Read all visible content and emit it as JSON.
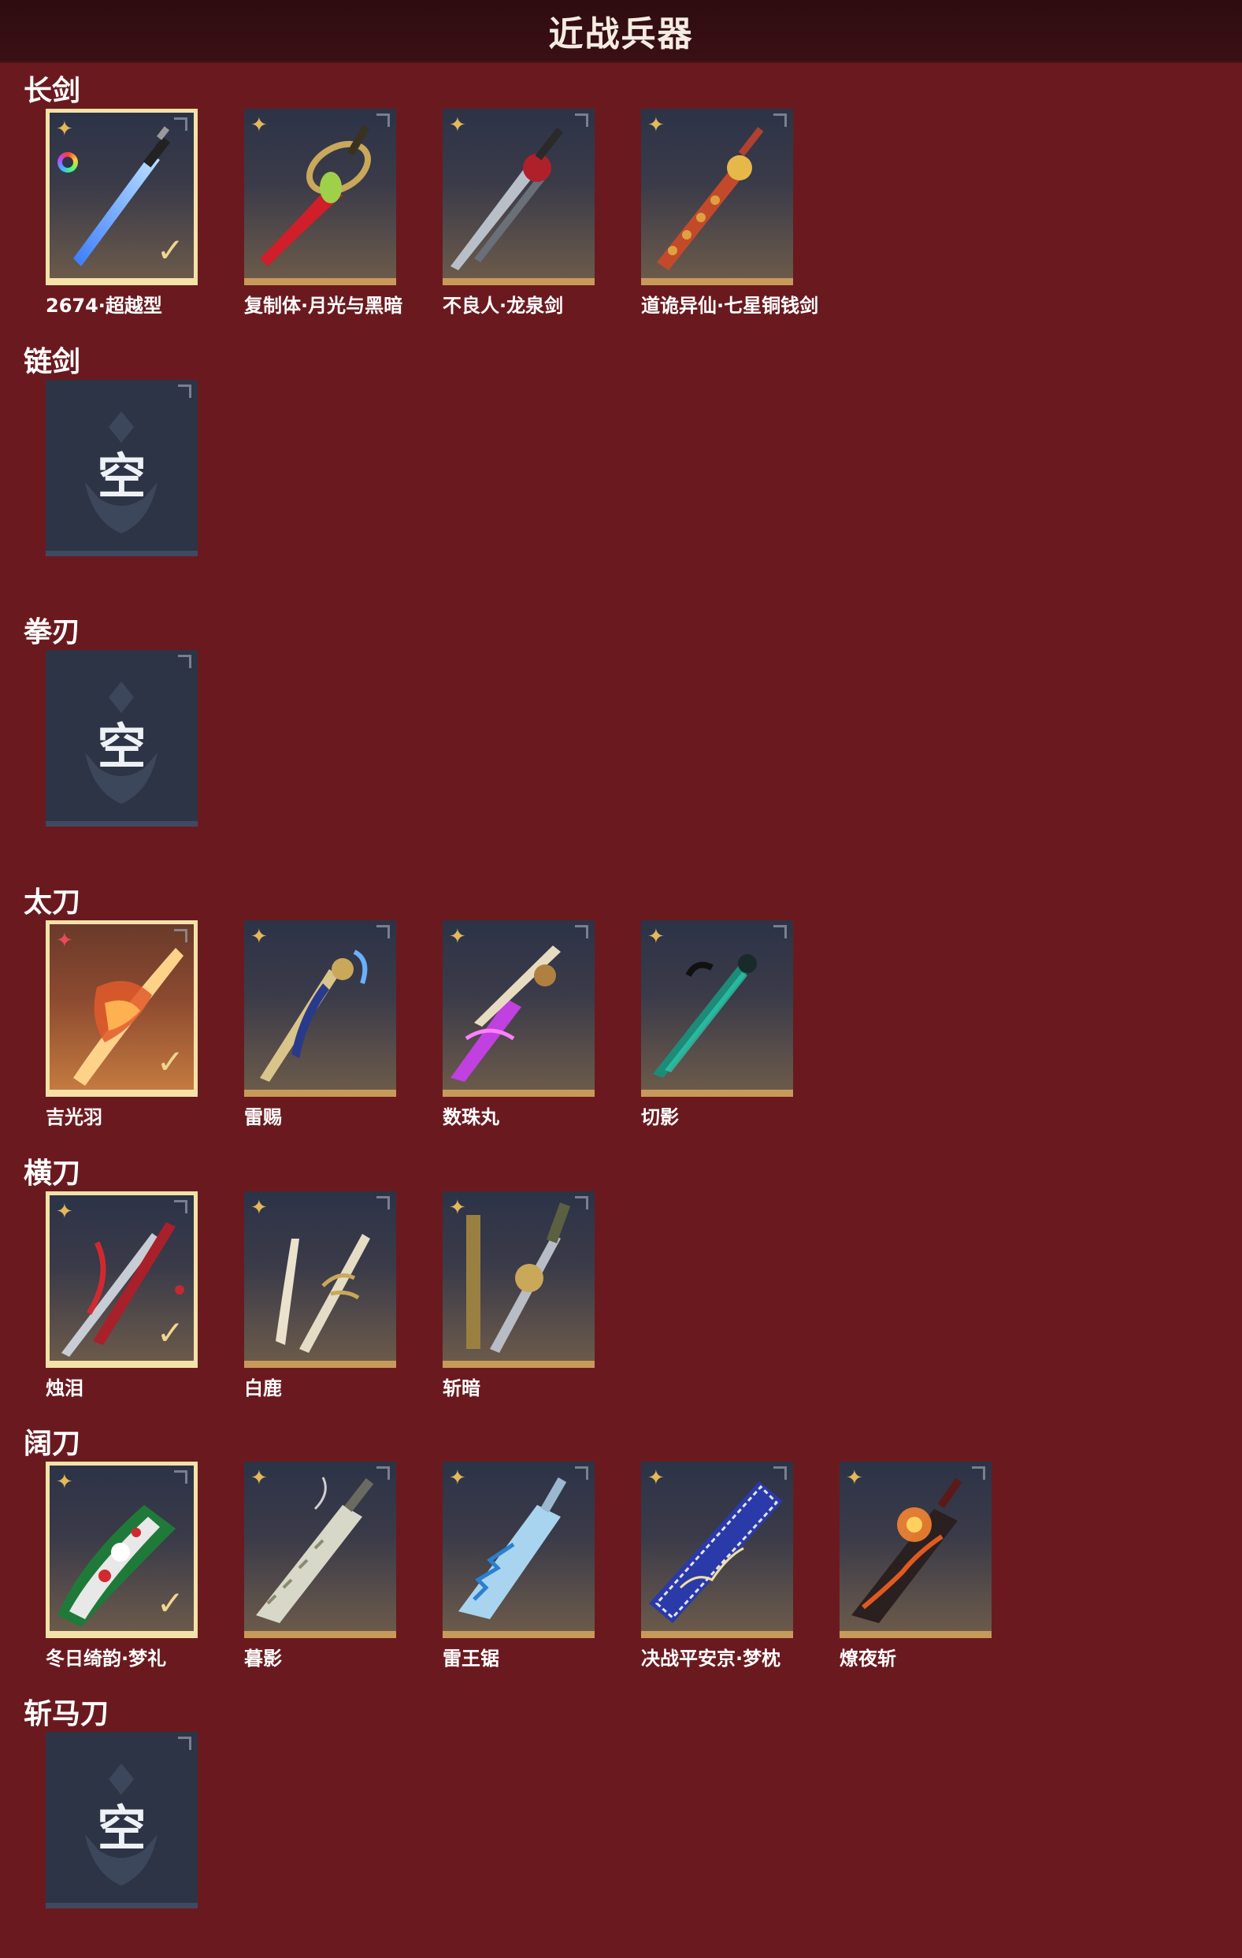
{
  "title": "近战兵器",
  "empty_label": "空",
  "equipped_glyph": "✓",
  "quality_glyph": "✦",
  "sections": [
    {
      "name": "长剑",
      "items": [
        "2674·超越型",
        "复制体·月光与黑暗",
        "不良人·龙泉剑",
        "道诡异仙·七星铜钱剑"
      ]
    },
    {
      "name": "链剑",
      "items": []
    },
    {
      "name": "拳刃",
      "items": []
    },
    {
      "name": "太刀",
      "items": [
        "吉光羽",
        "雷赐",
        "数珠丸",
        "切影"
      ]
    },
    {
      "name": "横刀",
      "items": [
        "烛泪",
        "白鹿",
        "斩暗"
      ]
    },
    {
      "name": "阔刀",
      "items": [
        "冬日绮韵·梦礼",
        "暮影",
        "雷王锯",
        "决战平安京·梦枕",
        "燎夜斩"
      ]
    },
    {
      "name": "斩马刀",
      "items": []
    }
  ],
  "colors": {
    "background": "#6a1a1f",
    "header": "#2e0c10",
    "gold_border": "#c89a5a",
    "equipped_border": "#f5e2a8",
    "empty_tile": "#2d3445"
  }
}
